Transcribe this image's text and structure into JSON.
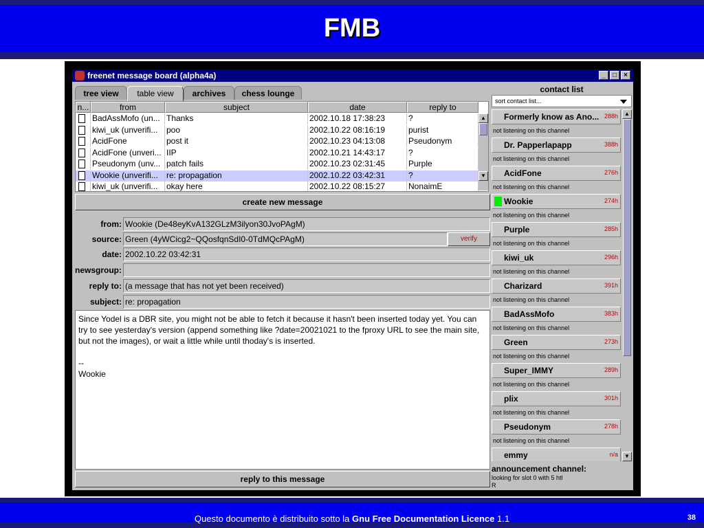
{
  "slide": {
    "title": "FMB",
    "footer_prefix": "Questo documento è distribuito sotto la ",
    "footer_bold": "Gnu Free Documentation Licence",
    "footer_suffix": " 1.1",
    "page_number": "38"
  },
  "window": {
    "title": "freenet message board (alpha4a)",
    "minimize_glyph": "_",
    "maximize_glyph": "□",
    "close_glyph": "×"
  },
  "tabs": [
    "tree view",
    "table view",
    "archives",
    "chess lounge"
  ],
  "active_tab": "table view",
  "table": {
    "columns": [
      "n...",
      "from",
      "subject",
      "date",
      "reply to"
    ],
    "rows": [
      {
        "from": "BadAssMofo (un...",
        "subject": "Thanks",
        "date": "2002.10.18 17:38:23",
        "reply_to": "?"
      },
      {
        "from": "kiwi_uk (unverifi...",
        "subject": "poo",
        "date": "2002.10.22 08:16:19",
        "reply_to": "purist"
      },
      {
        "from": "AcidFone",
        "subject": "post it",
        "date": "2002.10.23 04:13:08",
        "reply_to": "Pseudonym"
      },
      {
        "from": "AcidFone (unveri...",
        "subject": "IIP",
        "date": "2002.10.21 14:43:17",
        "reply_to": "?"
      },
      {
        "from": "Pseudonym (unv...",
        "subject": "patch fails",
        "date": "2002.10.23 02:31:45",
        "reply_to": "Purple"
      },
      {
        "from": "Wookie (unverifi...",
        "subject": "re: propagation",
        "date": "2002.10.22 03:42:31",
        "reply_to": "?"
      },
      {
        "from": "kiwi_uk (unverifi...",
        "subject": "okay here",
        "date": "2002.10.22 08:15:27",
        "reply_to": "NonaimE"
      }
    ],
    "selected_row": 5
  },
  "create_button": "create new message",
  "reply_button": "reply to this message",
  "message": {
    "labels": {
      "from": "from:",
      "source": "source:",
      "date": "date:",
      "newsgroup": "newsgroup:",
      "reply_to": "reply to:",
      "subject": "subject:"
    },
    "from": "Wookie (De48eyKvA132GLzM3ilyon30JvoPAgM)",
    "source": "Green (4yWCicg2~QQosfqnSdI0-0TdMQcPAgM)",
    "verify": "verify",
    "date": "2002.10.22 03:42:31",
    "newsgroup": "",
    "reply_to": "(a message that has not yet been received)",
    "subject": "re: propagation",
    "body": "Since Yodel is a DBR site, you might not be able to fetch it because it hasn't been inserted today yet. You can try to see yesterday's version (append something like ?date=20021021 to the fproxy URL to see the main site, but not the images), or wait a little while until thoday's is inserted.\n\n--\nWookie"
  },
  "contacts_panel": {
    "title": "contact list",
    "sort_placeholder": "sort contact list...",
    "contacts": [
      {
        "name": "Formerly know as Ano...",
        "hours": "288h",
        "status": "not listening on this channel",
        "online": false
      },
      {
        "name": "Dr. Papperlapapp",
        "hours": "388h",
        "status": "not listening on this channel",
        "online": false
      },
      {
        "name": "AcidFone",
        "hours": "276h",
        "status": "not listening on this channel",
        "online": false
      },
      {
        "name": "Wookie",
        "hours": "274h",
        "status": "not listening on this channel",
        "online": true
      },
      {
        "name": "Purple",
        "hours": "285h",
        "status": "not listening on this channel",
        "online": false
      },
      {
        "name": "kiwi_uk",
        "hours": "296h",
        "status": "not listening on this channel",
        "online": false
      },
      {
        "name": "Charizard",
        "hours": "391h",
        "status": "not listening on this channel",
        "online": false
      },
      {
        "name": "BadAssMofo",
        "hours": "383h",
        "status": "not listening on this channel",
        "online": false
      },
      {
        "name": "Green",
        "hours": "273h",
        "status": "not listening on this channel",
        "online": false
      },
      {
        "name": "Super_IMMY",
        "hours": "289h",
        "status": "not listening on this channel",
        "online": false
      },
      {
        "name": "plix",
        "hours": "301h",
        "status": "not listening on this channel",
        "online": false
      },
      {
        "name": "Pseudonym",
        "hours": "278h",
        "status": "not listening on this channel",
        "online": false
      },
      {
        "name": "emmy",
        "hours": "n/a",
        "status": "",
        "online": false
      }
    ],
    "announcement_title": "announcement channel:",
    "announcement_text": "looking for slot 0 with 5 htl",
    "announcement_extra": "R"
  },
  "colors": {
    "online_indicator": "#00ee00",
    "selected_row": "#ccccff",
    "hours_text": "#c00000"
  }
}
